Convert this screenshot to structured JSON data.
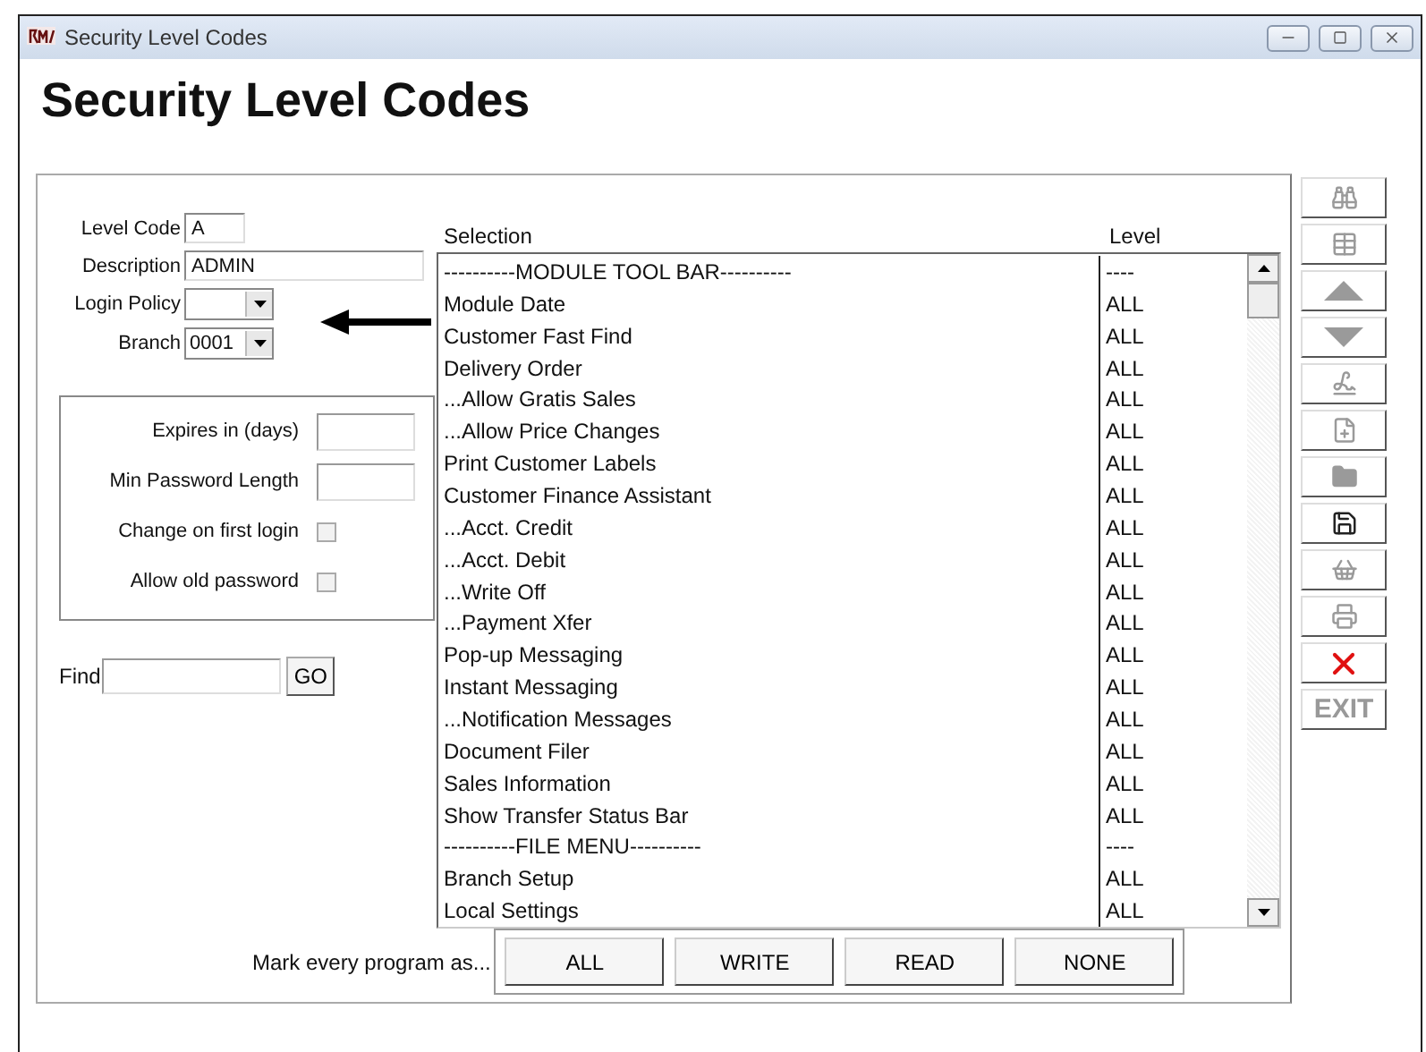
{
  "window": {
    "title": "Security Level Codes"
  },
  "heading": "Security Level Codes",
  "form": {
    "level_code": {
      "label": "Level Code",
      "value": "A"
    },
    "description": {
      "label": "Description",
      "value": "ADMIN"
    },
    "login_policy": {
      "label": "Login Policy"
    },
    "branch": {
      "label": "Branch",
      "value": "0001"
    }
  },
  "password_policy": {
    "expires": {
      "label": "Expires in (days)"
    },
    "min_length": {
      "label": "Min Password Length"
    },
    "checks": [
      {
        "label": "Change on first login",
        "checked": false
      },
      {
        "label": "Allow old password",
        "checked": false
      }
    ]
  },
  "find": {
    "label": "Find",
    "button": "GO"
  },
  "table": {
    "columns": [
      "Selection",
      "Level"
    ],
    "rows": [
      {
        "selection": "----------MODULE TOOL BAR----------",
        "level": "----"
      },
      {
        "selection": "Module Date",
        "level": "ALL"
      },
      {
        "selection": "Customer Fast Find",
        "level": "ALL"
      },
      {
        "selection": "Delivery Order",
        "level": "ALL"
      },
      {
        "selection": "...Allow Gratis Sales",
        "level": "ALL"
      },
      {
        "selection": "...Allow Price Changes",
        "level": "ALL"
      },
      {
        "selection": "Print Customer Labels",
        "level": "ALL"
      },
      {
        "selection": "Customer Finance Assistant",
        "level": "ALL"
      },
      {
        "selection": "...Acct. Credit",
        "level": "ALL"
      },
      {
        "selection": "...Acct. Debit",
        "level": "ALL"
      },
      {
        "selection": "...Write Off",
        "level": "ALL"
      },
      {
        "selection": "...Payment Xfer",
        "level": "ALL"
      },
      {
        "selection": "Pop-up Messaging",
        "level": "ALL"
      },
      {
        "selection": "Instant Messaging",
        "level": "ALL"
      },
      {
        "selection": "...Notification Messages",
        "level": "ALL"
      },
      {
        "selection": "Document Filer",
        "level": "ALL"
      },
      {
        "selection": "Sales Information",
        "level": "ALL"
      },
      {
        "selection": "Show Transfer Status Bar",
        "level": "ALL"
      },
      {
        "selection": "----------FILE MENU----------",
        "level": "----"
      },
      {
        "selection": "Branch Setup",
        "level": "ALL"
      },
      {
        "selection": "Local Settings",
        "level": "ALL"
      }
    ]
  },
  "mark_all": {
    "label": "Mark every program as...",
    "buttons": [
      "ALL",
      "WRITE",
      "READ",
      "NONE"
    ]
  },
  "toolbar": [
    {
      "kind": "binoculars",
      "disabled": true
    },
    {
      "kind": "grid",
      "disabled": true
    },
    {
      "kind": "up",
      "disabled": true
    },
    {
      "kind": "down",
      "disabled": true
    },
    {
      "kind": "signature",
      "disabled": true
    },
    {
      "kind": "add",
      "disabled": true
    },
    {
      "kind": "folder",
      "disabled": true
    },
    {
      "kind": "save",
      "disabled": false
    },
    {
      "kind": "basket",
      "disabled": true
    },
    {
      "kind": "printer",
      "disabled": true
    },
    {
      "kind": "delete",
      "disabled": false
    },
    {
      "kind": "text",
      "label": "EXIT",
      "disabled": true
    }
  ]
}
